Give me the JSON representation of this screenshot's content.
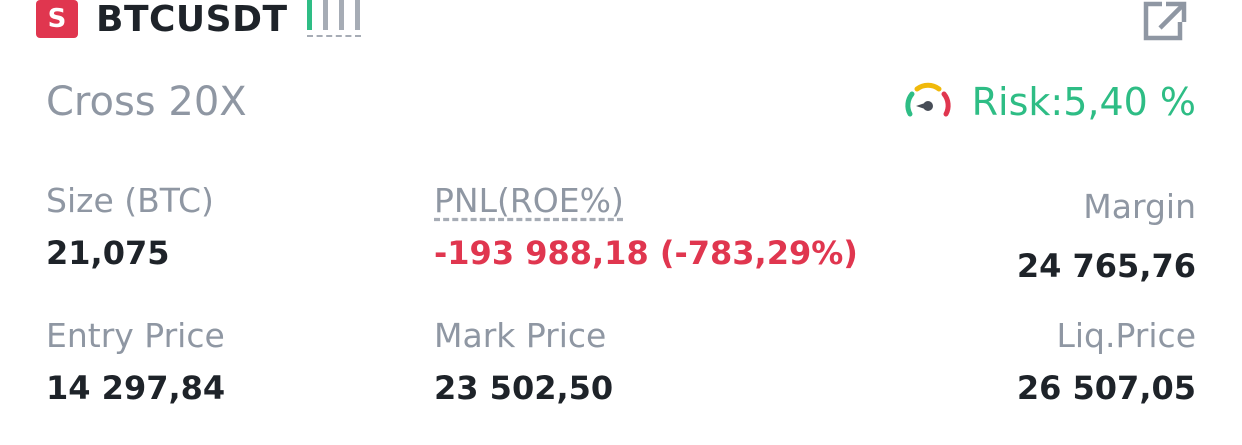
{
  "header": {
    "side_badge": "S",
    "symbol": "BTCUSDT",
    "icons": [
      "signal-bars-icon",
      "share-icon"
    ],
    "colors": {
      "sell": "#e0364f",
      "buy": "#2ebd85",
      "text": "#1e2329",
      "muted": "#8f97a3"
    }
  },
  "position": {
    "mode": "Cross 20X",
    "risk": "Risk:5,40 %",
    "risk_icon": "gauge-icon"
  },
  "fields": {
    "size": {
      "label": "Size (BTC)",
      "value": "21,075"
    },
    "pnl": {
      "label": "PNL(ROE%)",
      "value": "-193 988,18 (-783,29%)"
    },
    "margin": {
      "label": "Margin",
      "value": "24 765,76"
    },
    "entry_price": {
      "label": "Entry Price",
      "value": "14 297,84"
    },
    "mark_price": {
      "label": "Mark Price",
      "value": "23 502,50"
    },
    "liq_price": {
      "label": "Liq.Price",
      "value": "26 507,05"
    }
  }
}
